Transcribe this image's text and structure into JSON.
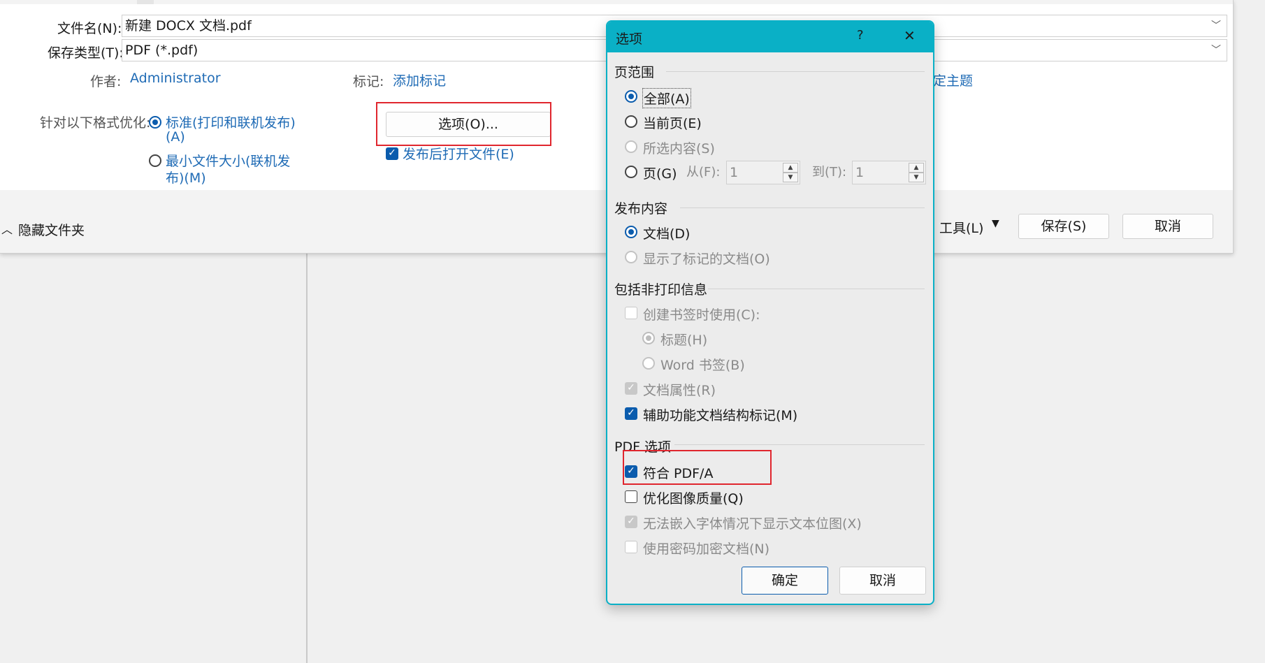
{
  "save_dialog": {
    "filename_label": "文件名(N):",
    "filename_value": "新建 DOCX 文档.pdf",
    "filetype_label": "保存类型(T):",
    "filetype_value": "PDF (*.pdf)",
    "author_label": "作者:",
    "author_value": "Administrator",
    "tags_label": "标记:",
    "tags_value": "添加标记",
    "subject_partial": "定主题",
    "optimize_label": "针对以下格式优化:",
    "opt_standard_line1": "标准(打印和联机发布)",
    "opt_standard_line2": "(A)",
    "opt_min_line1": "最小文件大小(联机发",
    "opt_min_line2": "布)(M)",
    "options_button": "选项(O)...",
    "open_after_publish": "发布后打开文件(E)",
    "hide_folders": "隐藏文件夹",
    "tools_label": "工具(L)",
    "save_button": "保存(S)",
    "cancel_button": "取消"
  },
  "options_dialog": {
    "title": "选项",
    "help": "?",
    "close": "✕",
    "page_range": {
      "heading": "页范围",
      "all": "全部(A)",
      "current": "当前页(E)",
      "selection": "所选内容(S)",
      "pages": "页(G)",
      "from_label": "从(F):",
      "from_value": "1",
      "to_label": "到(T):",
      "to_value": "1"
    },
    "publish_what": {
      "heading": "发布内容",
      "document": "文档(D)",
      "with_markup": "显示了标记的文档(O)"
    },
    "non_print": {
      "heading": "包括非打印信息",
      "create_bookmarks": "创建书签时使用(C):",
      "headings": "标题(H)",
      "word_bookmarks": "Word 书签(B)",
      "doc_properties": "文档属性(R)",
      "structure_tags": "辅助功能文档结构标记(M)"
    },
    "pdf_options": {
      "heading": "PDF 选项",
      "pdfa": "符合 PDF/A",
      "optimize_image": "优化图像质量(Q)",
      "bitmap_text": "无法嵌入字体情况下显示文本位图(X)",
      "encrypt": "使用密码加密文档(N)"
    },
    "ok": "确定",
    "cancel": "取消"
  },
  "colors": {
    "accent_teal": "#0ab0c6",
    "checkbox_blue": "#0b5cad",
    "link_blue": "#1f6bb5",
    "highlight_red": "#e0262e"
  }
}
